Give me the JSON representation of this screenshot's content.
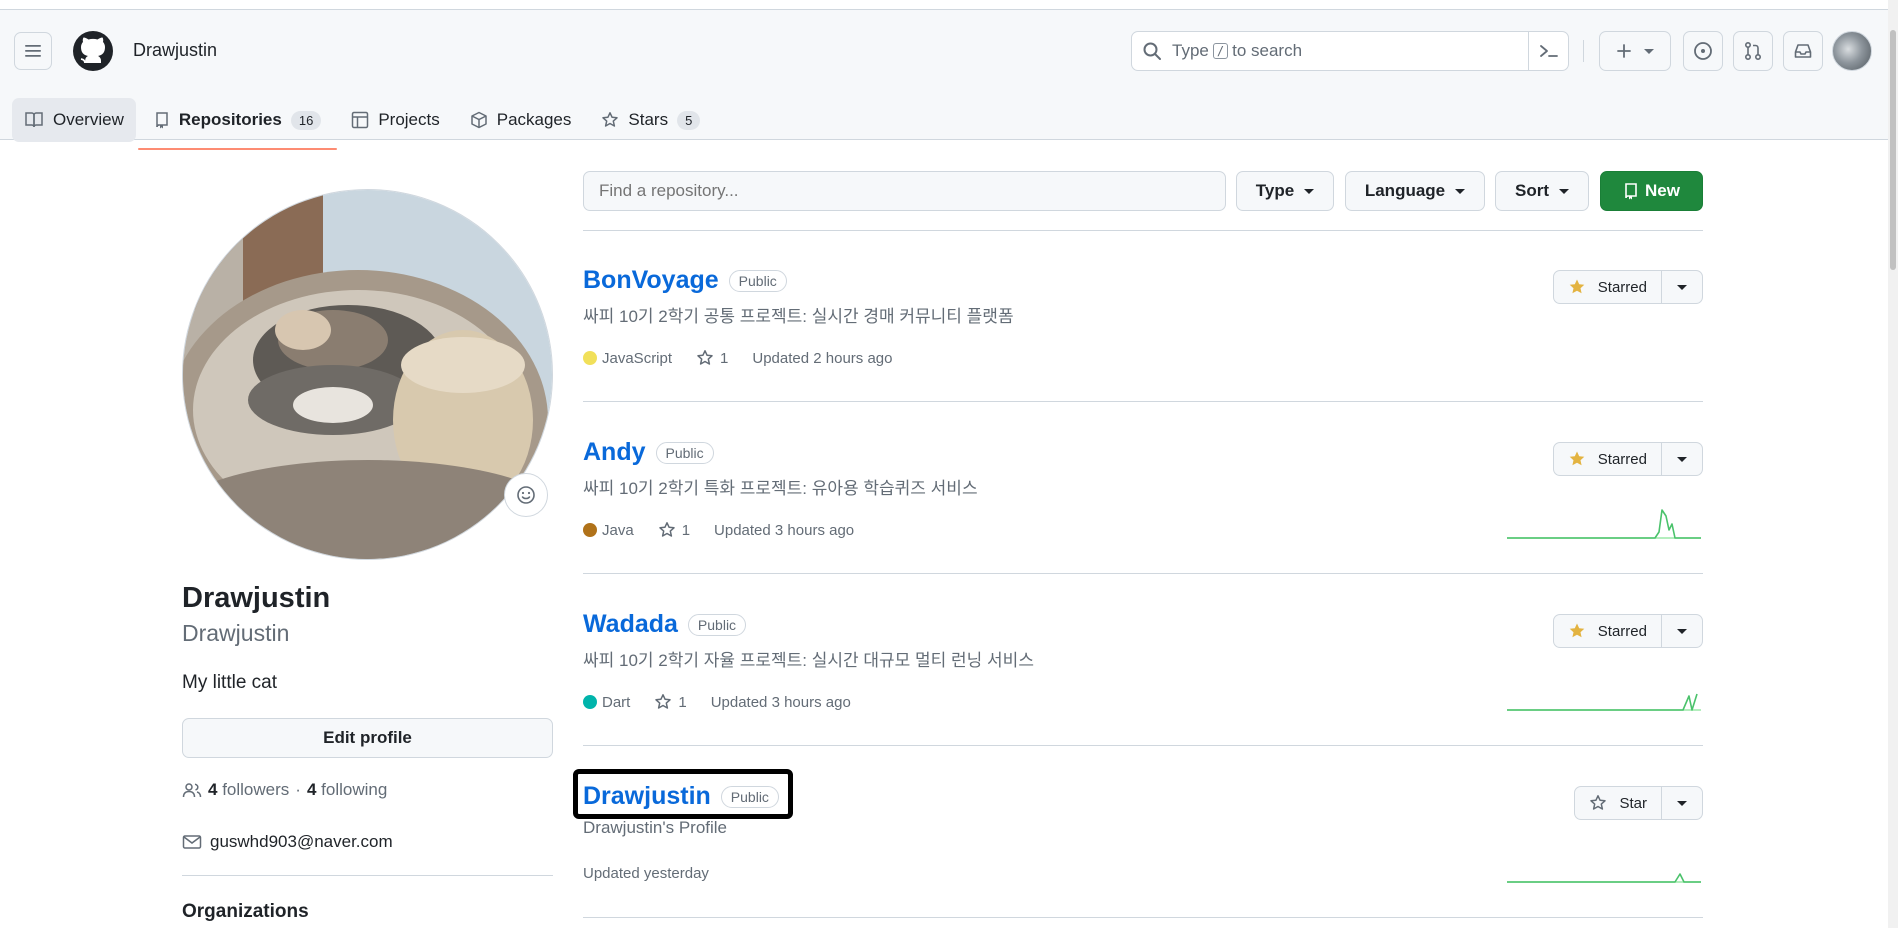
{
  "header": {
    "username": "Drawjustin",
    "search": {
      "prefix": "Type",
      "key": "/",
      "suffix": "to search"
    }
  },
  "tabs": [
    {
      "label": "Overview",
      "icon": "book-icon"
    },
    {
      "label": "Repositories",
      "icon": "repo-icon",
      "count": "16"
    },
    {
      "label": "Projects",
      "icon": "table-icon"
    },
    {
      "label": "Packages",
      "icon": "package-icon"
    },
    {
      "label": "Stars",
      "icon": "star-icon",
      "count": "5"
    }
  ],
  "profile": {
    "name": "Drawjustin",
    "login": "Drawjustin",
    "bio": "My little cat",
    "edit_label": "Edit profile",
    "followers_count": "4",
    "followers_label": "followers",
    "following_count": "4",
    "following_label": "following",
    "separator": "·",
    "email": "guswhd903@naver.com",
    "organizations_label": "Organizations"
  },
  "filters": {
    "find_placeholder": "Find a repository...",
    "type_label": "Type",
    "language_label": "Language",
    "sort_label": "Sort",
    "new_label": "New"
  },
  "repos": [
    {
      "name": "BonVoyage",
      "visibility": "Public",
      "description": "싸피 10기 2학기 공통 프로젝트: 실시간 경매 커뮤니티 플랫폼",
      "language": "JavaScript",
      "language_color": "#f1e05a",
      "stars": "1",
      "updated": "Updated 2 hours ago",
      "star_label": "Starred"
    },
    {
      "name": "Andy",
      "visibility": "Public",
      "description": "싸피 10기 2학기 특화 프로젝트: 유아용 학습퀴즈 서비스",
      "language": "Java",
      "language_color": "#b07219",
      "stars": "1",
      "updated": "Updated 3 hours ago",
      "star_label": "Starred"
    },
    {
      "name": "Wadada",
      "visibility": "Public",
      "description": "싸피 10기 2학기 자율 프로젝트: 실시간 대규모 멀티 런닝 서비스",
      "language": "Dart",
      "language_color": "#00B4AB",
      "stars": "1",
      "updated": "Updated 3 hours ago",
      "star_label": "Starred"
    },
    {
      "name": "Drawjustin",
      "visibility": "Public",
      "description": "Drawjustin's Profile",
      "updated": "Updated yesterday",
      "star_label": "Star"
    }
  ],
  "colors": {
    "accent": "#0969da",
    "primary_button": "#1f883d",
    "tab_underline": "#fd8c73",
    "starred_icon": "#e3b341",
    "sparkline": "#4ac26b"
  }
}
